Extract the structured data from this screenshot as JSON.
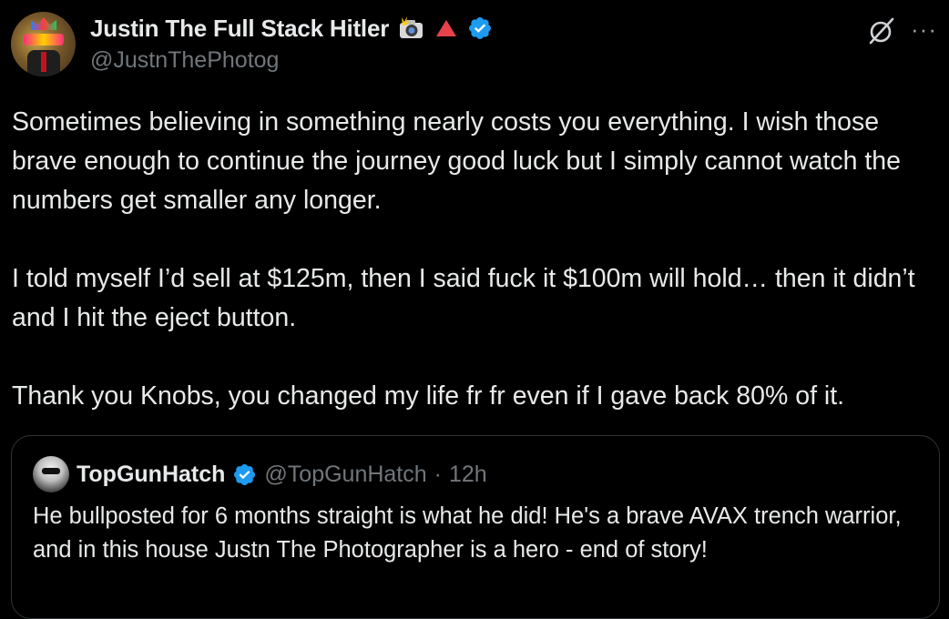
{
  "post": {
    "author": {
      "display_name": "Justin The Full Stack Hitler",
      "handle": "@JustnThePhotog",
      "badges": [
        "camera-flash-emoji",
        "red-triangle-emoji",
        "verified-badge"
      ]
    },
    "header_icons": [
      "grok-icon",
      "more-icon"
    ],
    "more_label": "···",
    "paragraphs": [
      "Sometimes believing in something nearly costs you everything. I wish those brave enough to continue the journey good luck but I simply cannot watch the numbers get smaller any longer.",
      "I told myself I’d sell at $125m, then I said fuck it $100m will hold… then it didn’t and I hit the eject button.",
      "Thank you Knobs, you changed my life fr fr even if I gave back 80% of it."
    ],
    "quote": {
      "display_name": "TopGunHatch",
      "handle": "@TopGunHatch",
      "separator": "·",
      "time": "12h",
      "text": "He bullposted for 6 months straight is what he did! He's a brave AVAX trench warrior, and in this house Justn The Photographer is a hero - end of story!"
    }
  },
  "colors": {
    "background": "#000000",
    "text_primary": "#e7e9ea",
    "text_secondary": "#71767b",
    "verified_blue": "#1d9bf0",
    "border": "#2f3336"
  }
}
